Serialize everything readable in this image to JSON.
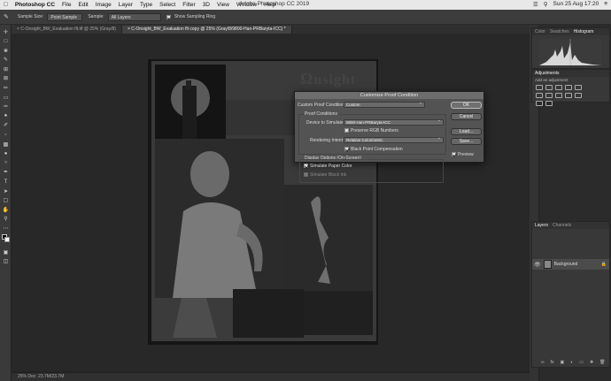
{
  "menubar": {
    "apple": "",
    "app": "Photoshop CC",
    "items": [
      "File",
      "Edit",
      "Image",
      "Layer",
      "Type",
      "Select",
      "Filter",
      "3D",
      "View",
      "Window",
      "Help"
    ],
    "window_title": "Adobe Photoshop CC 2019",
    "clock": "Sun 25 Aug  17:20"
  },
  "options": {
    "sample_size_label": "Sample Size:",
    "sample_size_value": "Point Sample",
    "sample_label": "Sample:",
    "sample_value": "All Layers",
    "show_ring_label": "Show Sampling Ring"
  },
  "tabs": [
    {
      "label": "C-Onsight_BW_Evaluation flt.tif @ 25% (Gray/8)"
    },
    {
      "label": "C-Onsight_BW_Evaluation flt copy @ 25% (Gray/8/9800-Han-PRBaryta-ICC) *"
    }
  ],
  "status": "25%    Doc: 23.7M/23.7M",
  "doc_logo": "nsight",
  "panels": {
    "top_tabs": [
      "Color",
      "Swatches",
      "Histogram"
    ],
    "adjustments_tab": "Adjustments",
    "adjustments_hint": "Add an adjustment",
    "layers_tabs": [
      "Layers",
      "Channels"
    ],
    "layer_name": "Background"
  },
  "dialog": {
    "title": "Customize Proof Condition",
    "condition_label": "Custom Proof Condition:",
    "condition_value": "Custom",
    "group_label": "Proof Conditions",
    "device_label": "Device to Simulate:",
    "device_value": "9800-Han-PRBaryta-ICC",
    "preserve_label": "Preserve RGB Numbers",
    "intent_label": "Rendering Intent:",
    "intent_value": "Relative Colorimetric",
    "bpc_label": "Black Point Compensation",
    "display_label": "Display Options (On-Screen)",
    "paper_label": "Simulate Paper Color",
    "ink_label": "Simulate Black Ink",
    "ok": "OK",
    "cancel": "Cancel",
    "load": "Load...",
    "save": "Save...",
    "preview": "Preview"
  }
}
